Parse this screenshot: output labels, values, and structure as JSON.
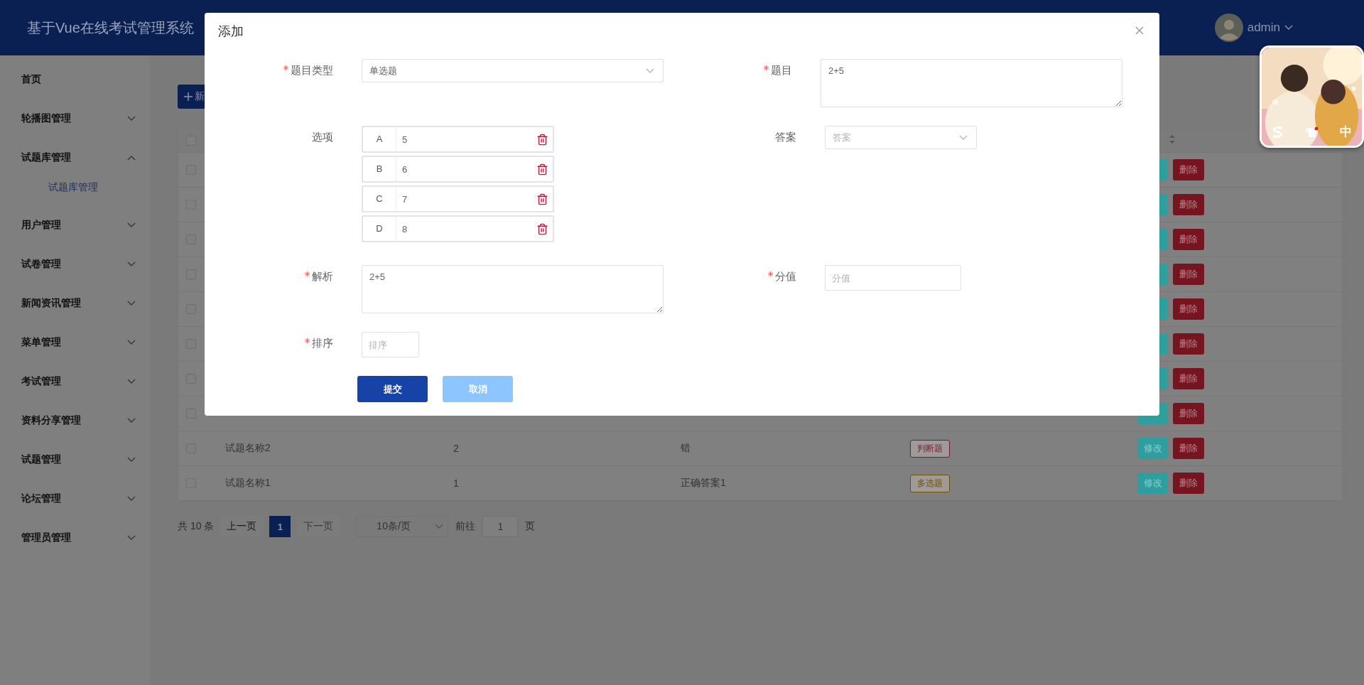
{
  "header": {
    "title": "基于Vue在线考试管理系统",
    "user": "admin"
  },
  "sidebar": {
    "items": [
      {
        "label": "首页",
        "kind": "link"
      },
      {
        "label": "轮播图管理",
        "kind": "submenu",
        "expanded": false
      },
      {
        "label": "试题库管理",
        "kind": "submenu",
        "expanded": true,
        "children": [
          {
            "label": "试题库管理",
            "selected": true
          }
        ]
      },
      {
        "label": "用户管理",
        "kind": "submenu",
        "expanded": false
      },
      {
        "label": "试卷管理",
        "kind": "submenu",
        "expanded": false
      },
      {
        "label": "新闻资讯管理",
        "kind": "submenu",
        "expanded": false
      },
      {
        "label": "菜单管理",
        "kind": "submenu",
        "expanded": false
      },
      {
        "label": "考试管理",
        "kind": "submenu",
        "expanded": false
      },
      {
        "label": "资料分享管理",
        "kind": "submenu",
        "expanded": false
      },
      {
        "label": "试题管理",
        "kind": "submenu",
        "expanded": false
      },
      {
        "label": "论坛管理",
        "kind": "submenu",
        "expanded": false
      },
      {
        "label": "管理员管理",
        "kind": "submenu",
        "expanded": false
      }
    ]
  },
  "toolbar": {
    "add_button": "新"
  },
  "table": {
    "header_checkbox": {
      "checked": false
    },
    "rows": [
      {
        "checked": false,
        "delete": "删除"
      },
      {
        "checked": false,
        "delete": "删除"
      },
      {
        "checked": false,
        "delete": "删除"
      },
      {
        "checked": false,
        "delete": "删除"
      },
      {
        "checked": false,
        "delete": "删除"
      },
      {
        "checked": false,
        "delete": "删除"
      },
      {
        "checked": false,
        "delete": "删除"
      },
      {
        "checked": false,
        "delete": "删除"
      },
      {
        "checked": false,
        "name": "试题名称2",
        "column_2": "2",
        "answer": "错",
        "type": {
          "label": "判断题",
          "color": "#7a1a30"
        },
        "edit": "修改",
        "delete": "删除"
      },
      {
        "checked": false,
        "name": "试题名称1",
        "column_2": "1",
        "answer": "正确答案1",
        "type": {
          "label": "多选题",
          "color": "#6a5200"
        },
        "edit": "修改",
        "delete": "删除"
      }
    ]
  },
  "pagination": {
    "total": "共 10 条",
    "prev": "上一页",
    "pages": [
      {
        "label": "1",
        "selected": true
      }
    ],
    "next": {
      "label": "下一页",
      "disabled": true
    },
    "page_size": "10条/页",
    "goto": "前往",
    "goto_value": "1",
    "page_unit": "页"
  },
  "dialog": {
    "title": "添加",
    "rows": [
      [
        {
          "kind": "select",
          "label": "题目类型",
          "required": true,
          "value": "单选题"
        },
        {
          "kind": "textarea",
          "label": "题目",
          "required": true,
          "value": "2+5"
        }
      ],
      [
        {
          "kind": "options",
          "label": "选项",
          "required": false,
          "options": [
            {
              "letter": "A",
              "value": "5"
            },
            {
              "letter": "B",
              "value": "6"
            },
            {
              "letter": "C",
              "value": "7"
            },
            {
              "letter": "D",
              "value": "8"
            }
          ]
        },
        {
          "kind": "select",
          "label": "答案",
          "required": false,
          "placeholder": "答案"
        }
      ],
      [
        {
          "kind": "textarea",
          "label": "解析",
          "required": true,
          "value": "2+5"
        },
        {
          "kind": "input",
          "label": "分值",
          "required": true,
          "placeholder": "分值"
        }
      ],
      [
        {
          "kind": "input",
          "label": "排序",
          "required": true,
          "placeholder": "排序"
        }
      ]
    ],
    "buttons": [
      {
        "label": "提交",
        "kind": "primary"
      },
      {
        "label": "取消",
        "kind": "cancel"
      }
    ]
  },
  "ime_widget": {
    "mode": "中"
  }
}
